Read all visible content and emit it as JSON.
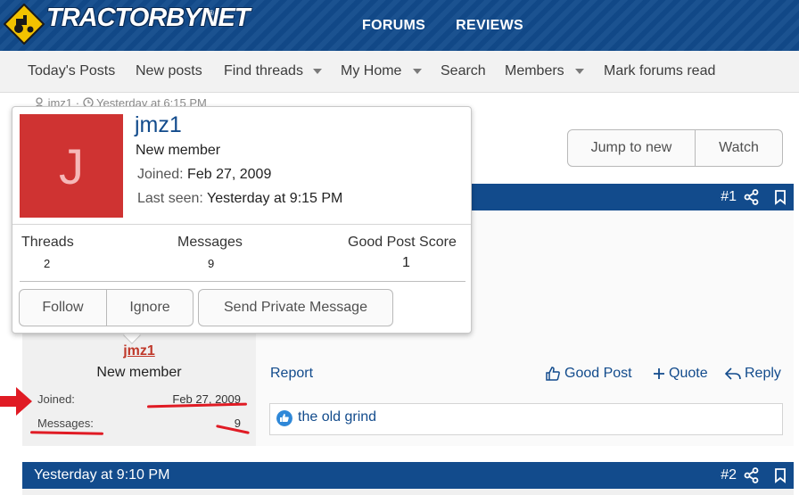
{
  "header": {
    "logo_text": "TRACTORBYNET",
    "logo_tm": "®",
    "nav": [
      "FORUMS",
      "REVIEWS"
    ]
  },
  "subnav": {
    "items": [
      "Today's Posts",
      "New posts",
      "Find threads",
      "My Home",
      "Search",
      "Members",
      "Mark forums read"
    ]
  },
  "thread_meta": {
    "author": "jmz1",
    "time": "Yesterday at 6:15 PM"
  },
  "thread_actions": {
    "jump_label": "Jump to new",
    "watch_label": "Watch"
  },
  "member_tooltip": {
    "avatar_letter": "J",
    "name": "jmz1",
    "title": "New member",
    "joined_label": "Joined:",
    "joined_value": "Feb 27, 2009",
    "last_seen_label": "Last seen:",
    "last_seen_value": "Yesterday at 9:15 PM",
    "stats": [
      {
        "label": "Threads",
        "value": "2"
      },
      {
        "label": "Messages",
        "value": "9"
      },
      {
        "label": "Good Post Score",
        "value": "1"
      }
    ],
    "follow_label": "Follow",
    "ignore_label": "Ignore",
    "pm_label": "Send Private Message"
  },
  "post1": {
    "number": "#1",
    "username": "jmz1",
    "user_title": "New member",
    "joined_label": "Joined:",
    "joined_value": "Feb 27, 2009",
    "messages_label": "Messages:",
    "messages_value": "9",
    "report_label": "Report",
    "good_post_label": "Good Post",
    "quote_label": "Quote",
    "reply_label": "Reply",
    "reaction_text": "the old grind"
  },
  "post2": {
    "date": "Yesterday at 9:10 PM",
    "number": "#2"
  },
  "colors": {
    "brand_blue": "#124b8c",
    "avatar_red": "#cf3332",
    "annotation_red": "#e01b24"
  },
  "icons": [
    "tractor-logo-icon",
    "user-icon",
    "clock-icon",
    "share-icon",
    "bookmark-icon",
    "thumbs-up-icon",
    "plus-icon",
    "reply-arrow-icon",
    "like-reaction-icon",
    "red-arrow-annotation"
  ]
}
